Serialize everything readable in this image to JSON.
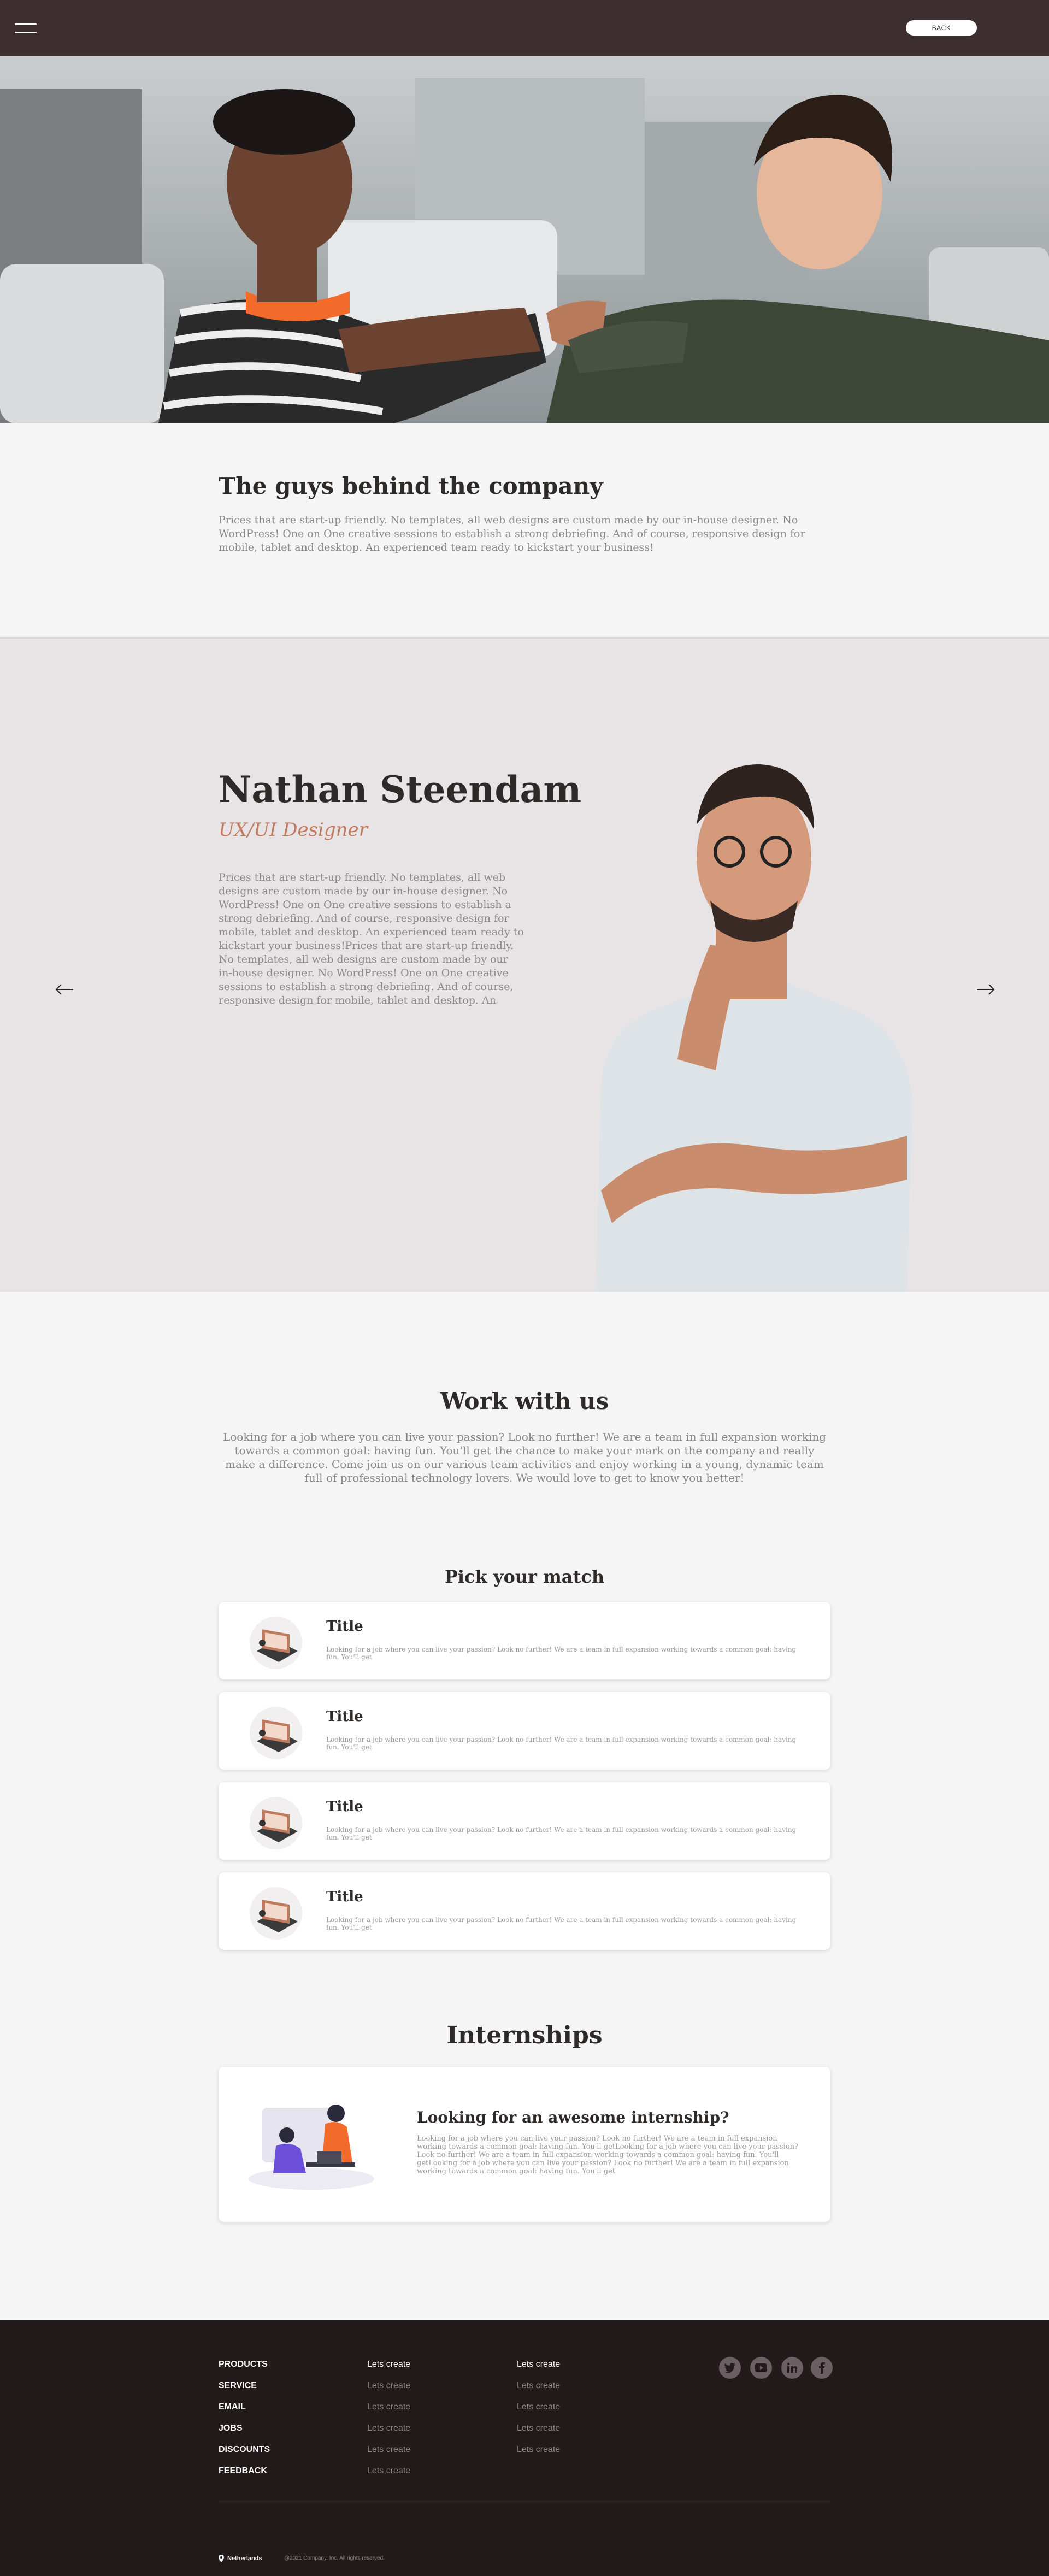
{
  "header": {
    "back_label": "BACK"
  },
  "intro": {
    "title": "The guys behind the company",
    "text": "Prices that are start-up friendly. No templates, all web designs are custom made by our in-house designer. No WordPress! One on One creative sessions to establish a strong debriefing. And of course, responsive design for mobile, tablet and desktop. An experienced team ready to kickstart your business!"
  },
  "team": {
    "name": "Nathan Steendam",
    "role": "UX/UI Designer",
    "bio": "Prices that are start-up friendly. No templates, all web designs are custom made by our in-house designer. No WordPress! One on One creative sessions to establish a strong debriefing. And of course, responsive design for mobile, tablet and desktop. An experienced team ready to kickstart your business!Prices that are start-up friendly. No templates, all web designs are custom made by our in-house designer. No WordPress! One on One creative sessions to establish a strong debriefing. And of course, responsive design for mobile, tablet and desktop. An experienced team ready to kickstart your"
  },
  "work": {
    "title": "Work with us",
    "text": "Looking for a job where you can live your passion? Look no further! We are a team in full expansion working towards a common goal: having fun. You'll get the chance to make your mark on the company and really make a difference. Come join us on our various team activities and enjoy working in a young, dynamic team full of professional technology lovers. We would love to get to know you better!",
    "pick_title": "Pick your match",
    "jobs": [
      {
        "title": "Title",
        "desc": "Looking for a job where you can live your passion? Look no further! We are a team in full expansion working towards a common goal: having fun. You'll get"
      },
      {
        "title": "Title",
        "desc": "Looking for a job where you can live your passion? Look no further! We are a team in full expansion working towards a common goal: having fun. You'll get"
      },
      {
        "title": "Title",
        "desc": "Looking for a job where you can live your passion? Look no further! We are a team in full expansion working towards a common goal: having fun. You'll get"
      },
      {
        "title": "Title",
        "desc": "Looking for a job where you can live your passion? Look no further! We are a team in full expansion working towards a common goal: having fun. You'll get"
      }
    ]
  },
  "internships": {
    "title": "Internships",
    "card_title": "Looking for an awesome internship?",
    "card_text": "Looking for a job where you can live your passion? Look no further! We are a team in full expansion working towards a common goal: having fun. You'll getLooking for a job where you can live your passion? Look no further! We are a team in full expansion working towards a common goal: having fun. You'll getLooking for a job where you can live your passion? Look no further! We are a team in full expansion working towards a common goal: having fun. You'll get"
  },
  "footer": {
    "col1": [
      "PRODUCTS",
      "SERVICE",
      "EMAIL",
      "JOBS",
      "DISCOUNTS",
      "FEEDBACK"
    ],
    "col2": [
      "Lets create",
      "Lets create",
      "Lets create",
      "Lets create",
      "Lets create",
      "Lets create"
    ],
    "col3": [
      "Lets create",
      "Lets create",
      "Lets create",
      "Lets create",
      "Lets create"
    ],
    "location": "Netherlands",
    "copyright": "@2021 Company, Inc. All rights reserved.",
    "social": [
      "twitter-icon",
      "youtube-icon",
      "linkedin-icon",
      "facebook-icon"
    ]
  },
  "colors": {
    "header": "#3d2e2f",
    "accent": "#c27a5f",
    "footer": "#221a1b"
  }
}
